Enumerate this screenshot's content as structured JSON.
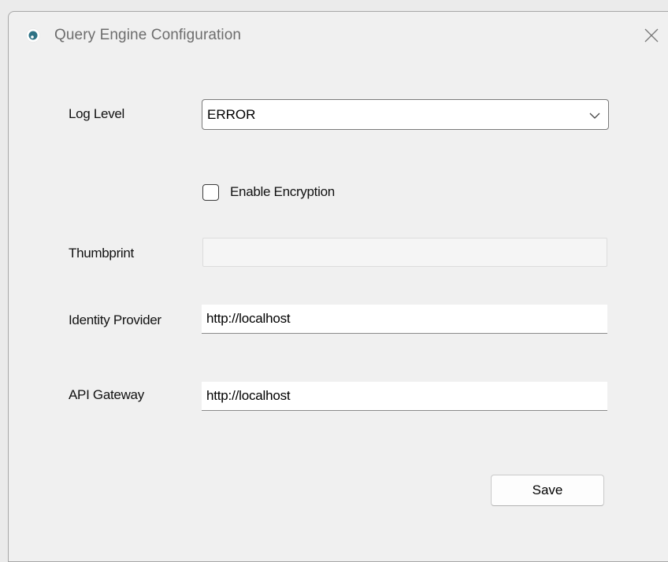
{
  "window": {
    "title": "Query Engine Configuration",
    "icon": "app-circle-icon",
    "close_icon": "close-icon"
  },
  "form": {
    "log_level": {
      "label": "Log Level",
      "selected": "ERROR"
    },
    "encryption": {
      "label": "Enable  Encryption",
      "checked": false
    },
    "thumbprint": {
      "label": "Thumbprint",
      "value": "",
      "disabled": true
    },
    "identity_provider": {
      "label": "Identity Provider",
      "value": "http://localhost"
    },
    "api_gateway": {
      "label": "API Gateway",
      "value": "http://localhost"
    }
  },
  "actions": {
    "save_label": "Save"
  },
  "colors": {
    "window_bg": "#f0f0f0",
    "icon_teal": "#2e7285"
  }
}
